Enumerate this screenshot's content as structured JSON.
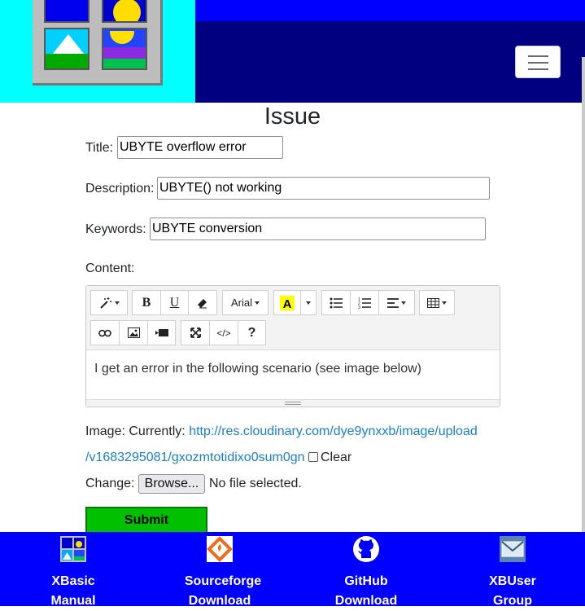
{
  "header": {
    "logo_alt": "XBasic logo",
    "menu_toggle_label": "Toggle navigation"
  },
  "page": {
    "title": "Issue"
  },
  "form": {
    "title_label": "Title:",
    "title_value": "UBYTE overflow error",
    "description_label": "Description:",
    "description_value": "UBYTE() not working",
    "keywords_label": "Keywords:",
    "keywords_value": "UBYTE conversion",
    "content_label": "Content:",
    "editor": {
      "font_name": "Arial",
      "help_label": "?",
      "code_view_label": "</>",
      "bold_label": "B",
      "underline_label": "U",
      "body_text": "I get an error in the following scenario (see image below)"
    },
    "image_label": "Image:",
    "currently_label": "Currently:",
    "image_link_line1": "http://res.cloudinary.com/dye9ynxxb/image/upload",
    "image_link_line2": "/v1683295081/gxozmtotidixo0sum0gn",
    "clear_label": "Clear",
    "change_label": "Change:",
    "browse_label": "Browse...",
    "no_file_text": "No file selected.",
    "submit_label": "Submit"
  },
  "footer": {
    "items": [
      {
        "line1": "XBasic",
        "line2": "Manual"
      },
      {
        "line1": "Sourceforge",
        "line2": "Download"
      },
      {
        "line1": "GitHub",
        "line2": "Download"
      },
      {
        "line1": "XBUser",
        "line2": "Group"
      }
    ]
  },
  "colors": {
    "logo_bg": "#00ffff",
    "navbar": "#000080",
    "footer": "#0000ff",
    "submit": "#00c000",
    "link": "#1a7fd1"
  }
}
